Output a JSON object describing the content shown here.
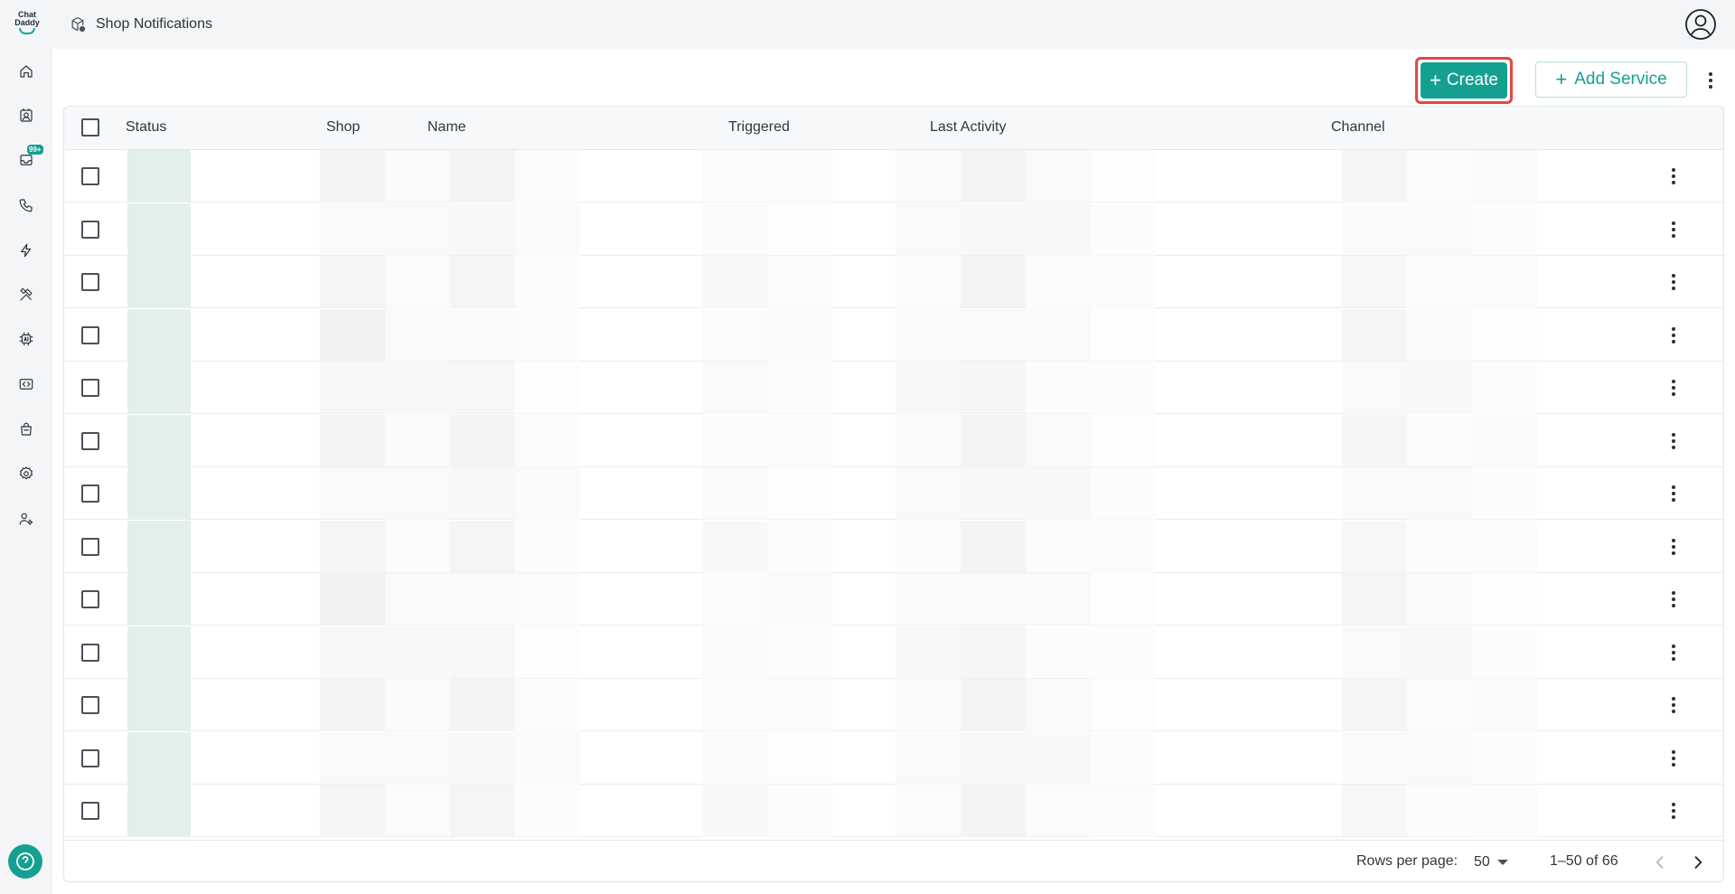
{
  "app": {
    "logo_line1": "Chat",
    "logo_line2": "Daddy",
    "page_title": "Shop Notifications"
  },
  "sidebar": {
    "items": [
      {
        "icon": "home-icon"
      },
      {
        "icon": "contacts-icon"
      },
      {
        "icon": "inbox-icon",
        "badge": "99+"
      },
      {
        "icon": "phone-icon"
      },
      {
        "icon": "lightning-icon"
      },
      {
        "icon": "tools-icon"
      },
      {
        "icon": "ai-chip-icon"
      },
      {
        "icon": "code-icon"
      },
      {
        "icon": "shopping-bag-icon"
      },
      {
        "icon": "settings-icon"
      },
      {
        "icon": "team-settings-icon"
      }
    ],
    "help_icon": "help-icon"
  },
  "toolbar": {
    "create_label": "Create",
    "add_service_label": "Add Service"
  },
  "table": {
    "columns": [
      "Status",
      "Shop",
      "Name",
      "Triggered",
      "Last Activity",
      "Channel"
    ],
    "row_count_visible": 13
  },
  "pagination": {
    "rows_per_page_label": "Rows per page:",
    "rows_per_page_value": "50",
    "range_text": "1–50 of 66"
  },
  "colors": {
    "accent": "#14a091",
    "highlight": "#e5473f"
  }
}
